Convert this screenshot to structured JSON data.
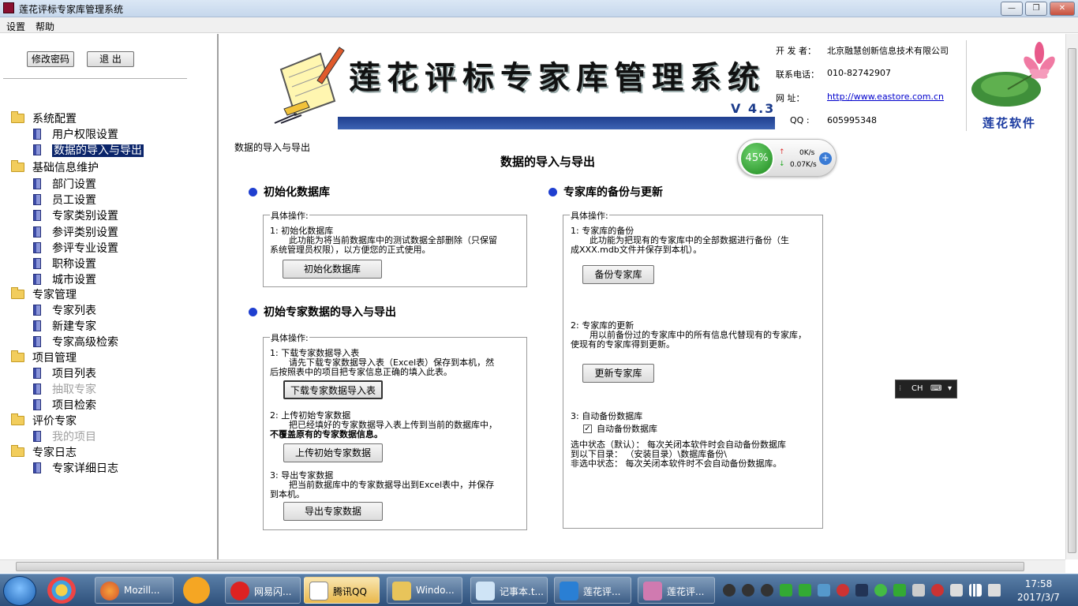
{
  "window": {
    "title": "莲花评标专家库管理系统",
    "controls": {
      "minimize": "—",
      "maximize": "❐",
      "close": "✕"
    }
  },
  "menu": {
    "settings": "设置",
    "help": "帮助"
  },
  "left": {
    "change_password": "修改密码",
    "exit": "退  出",
    "tree": {
      "system_config": "系统配置",
      "user_permissions": "用户权限设置",
      "data_import_export": "数据的导入与导出",
      "basic_info": "基础信息维护",
      "department": "部门设置",
      "staff": "员工设置",
      "expert_category": "专家类别设置",
      "review_category": "参评类别设置",
      "review_major": "参评专业设置",
      "title_setting": "职称设置",
      "city": "城市设置",
      "expert_mgmt": "专家管理",
      "expert_list": "专家列表",
      "new_expert": "新建专家",
      "advanced_search": "专家高级检索",
      "project_mgmt": "项目管理",
      "project_list": "项目列表",
      "draw_expert": "抽取专家",
      "project_search": "项目检索",
      "evaluate_expert": "评价专家",
      "my_projects": "我的项目",
      "expert_log": "专家日志",
      "expert_detail_log": "专家详细日志"
    }
  },
  "banner": {
    "title": "莲花评标专家库管理系统",
    "version": "V 4.3",
    "developer_label": "开 发 者：",
    "developer": "北京融慧创新信息技术有限公司",
    "phone_label": "联系电话：",
    "phone": "010-82742907",
    "website_label": "网    址：",
    "website": "http://www.eastore.com.cn",
    "qq_label": "QQ   :",
    "qq": "605995348",
    "brand": "莲花软件"
  },
  "content": {
    "breadcrumb": "数据的导入与导出",
    "heading": "数据的导入与导出",
    "init_db": {
      "title": "初始化数据库",
      "legend": "具体操作:",
      "step1_title": "1:  初始化数据库",
      "step1_line1": "此功能为将当前数据库中的测试数据全部删除（只保留",
      "step1_line2": "系统管理员权限），以方便您的正式使用。",
      "button": "初始化数据库"
    },
    "import_export": {
      "title": "初始专家数据的导入与导出",
      "legend": "具体操作:",
      "step1_title": "1:  下载专家数据导入表",
      "step1_line1": "请先下载专家数据导入表（Excel表）保存到本机，然",
      "step1_line2": "后按照表中的项目把专家信息正确的填入此表。",
      "button1": "下载专家数据导入表",
      "step2_title": "2:  上传初始专家数据",
      "step2_line1": "把已经填好的专家数据导入表上传到当前的数据库中，",
      "step2_line2": "不覆盖原有的专家数据信息。",
      "button2": "上传初始专家数据",
      "step3_title": "3:  导出专家数据",
      "step3_line1": "把当前数据库中的专家数据导出到Excel表中，并保存",
      "step3_line2": "到本机。",
      "button3": "导出专家数据"
    },
    "backup": {
      "title": "专家库的备份与更新",
      "legend": "具体操作:",
      "step1_title": "1:  专家库的备份",
      "step1_line1": "此功能为把现有的专家库中的全部数据进行备份（生",
      "step1_line2": "成XXX.mdb文件并保存到本机）。",
      "button1": "备份专家库",
      "step2_title": "2:  专家库的更新",
      "step2_line1": "用以前备份过的专家库中的所有信息代替现有的专家库，",
      "step2_line2": "使现有的专家库得到更新。",
      "button2": "更新专家库",
      "step3_title": "3:  自动备份数据库",
      "checkbox_label": "自动备份数据库",
      "checkbox_checked": "✓",
      "note1": "选中状态（默认）：  每次关闭本软件时会自动备份数据库",
      "note2": "到以下目录：  （安装目录）\\数据库备份\\",
      "note3": "非选中状态：  每次关闭本软件时不会自动备份数据库。"
    }
  },
  "net_widget": {
    "percent": "45%",
    "up": "0K/s",
    "down": "0.07K/s",
    "up_arrow": "↑",
    "down_arrow": "↓",
    "plus": "+"
  },
  "ime": {
    "lang": "CH"
  },
  "taskbar": {
    "tasks": [
      "Mozill...",
      "网易闪...",
      "腾讯QQ",
      "Windo...",
      "记事本.t...",
      "莲花评...",
      "莲花评..."
    ],
    "time": "17:58",
    "date": "2017/3/7"
  }
}
